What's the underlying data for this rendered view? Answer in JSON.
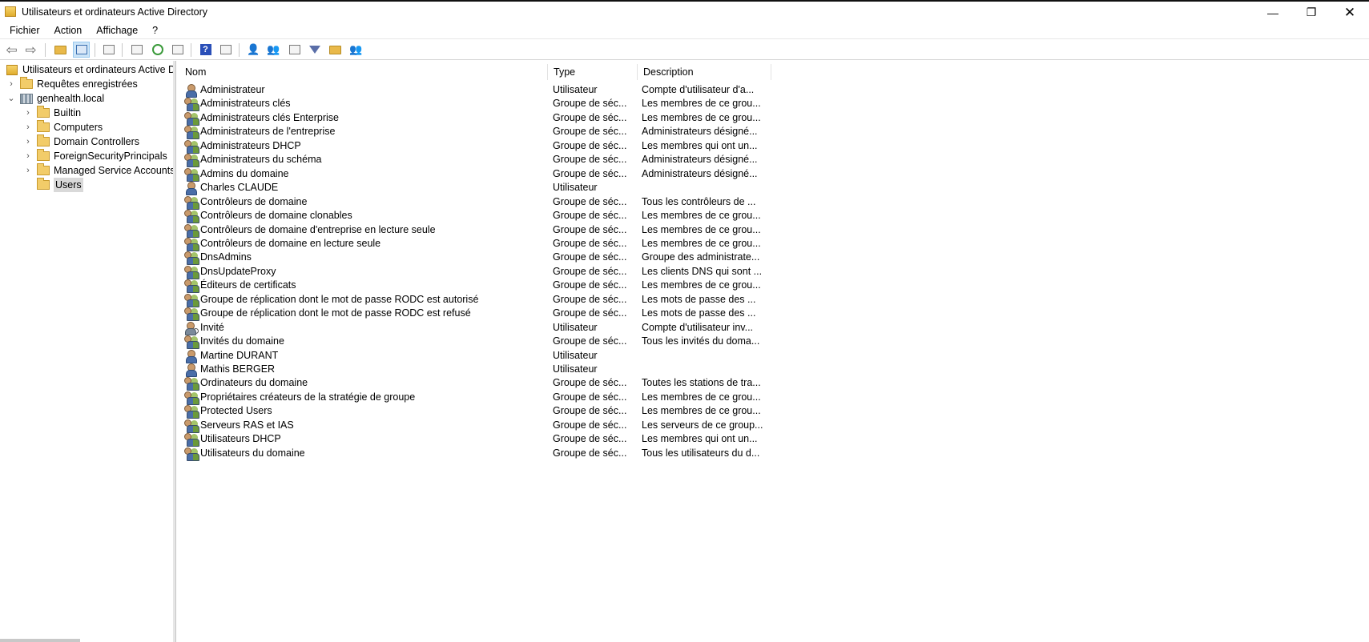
{
  "window": {
    "title": "Utilisateurs et ordinateurs Active Directory",
    "min_glyph": "—",
    "max_glyph": "❐",
    "close_glyph": "✕"
  },
  "menu": [
    "Fichier",
    "Action",
    "Affichage",
    "?"
  ],
  "toolbar": {
    "buttons": [
      {
        "name": "back-button",
        "icon": "arrow-left-icon"
      },
      {
        "name": "forward-button",
        "icon": "arrow-right-icon"
      },
      {
        "name": "up-level-button",
        "icon": "folder-up-icon"
      },
      {
        "name": "show-hide-tree-button",
        "icon": "console-tree-icon",
        "selected": true
      },
      {
        "name": "clipboard-button",
        "icon": "clipboard-icon"
      },
      {
        "name": "properties-button",
        "icon": "properties-icon"
      },
      {
        "name": "refresh-button",
        "icon": "refresh-icon"
      },
      {
        "name": "export-list-button",
        "icon": "export-icon"
      },
      {
        "name": "help-button",
        "icon": "help-icon"
      },
      {
        "name": "action-pane-button",
        "icon": "pane-icon"
      },
      {
        "name": "new-user-button",
        "icon": "new-user-icon"
      },
      {
        "name": "new-group-button",
        "icon": "new-group-icon"
      },
      {
        "name": "new-ou-button",
        "icon": "new-ou-icon"
      },
      {
        "name": "filter-button",
        "icon": "filter-icon"
      },
      {
        "name": "find-button",
        "icon": "find-icon"
      },
      {
        "name": "add-to-group-button",
        "icon": "add-to-group-icon"
      }
    ]
  },
  "tree": {
    "root": "Utilisateurs et ordinateurs Active Directory",
    "items": [
      {
        "label": "Requêtes enregistrées",
        "chevron": "›",
        "level": 1
      },
      {
        "label": "genhealth.local",
        "chevron": "⌄",
        "level": 1
      },
      {
        "label": "Builtin",
        "chevron": "›",
        "level": 2
      },
      {
        "label": "Computers",
        "chevron": "›",
        "level": 2
      },
      {
        "label": "Domain Controllers",
        "chevron": "›",
        "level": 2
      },
      {
        "label": "ForeignSecurityPrincipals",
        "chevron": "›",
        "level": 2
      },
      {
        "label": "Managed Service Accounts",
        "chevron": "›",
        "level": 2
      },
      {
        "label": "Users",
        "chevron": "",
        "level": 2,
        "selected": true
      }
    ]
  },
  "list": {
    "columns": {
      "name": "Nom",
      "type": "Type",
      "description": "Description"
    },
    "rows": [
      {
        "name": "Administrateur",
        "type": "Utilisateur",
        "desc": "Compte d'utilisateur d'a...",
        "kind": "user"
      },
      {
        "name": "Administrateurs clés",
        "type": "Groupe de séc...",
        "desc": "Les membres de ce grou...",
        "kind": "group"
      },
      {
        "name": "Administrateurs clés Enterprise",
        "type": "Groupe de séc...",
        "desc": "Les membres de ce grou...",
        "kind": "group"
      },
      {
        "name": "Administrateurs de l'entreprise",
        "type": "Groupe de séc...",
        "desc": "Administrateurs désigné...",
        "kind": "group"
      },
      {
        "name": "Administrateurs DHCP",
        "type": "Groupe de séc...",
        "desc": "Les membres qui ont un...",
        "kind": "group"
      },
      {
        "name": "Administrateurs du schéma",
        "type": "Groupe de séc...",
        "desc": "Administrateurs désigné...",
        "kind": "group"
      },
      {
        "name": "Admins du domaine",
        "type": "Groupe de séc...",
        "desc": "Administrateurs désigné...",
        "kind": "group"
      },
      {
        "name": "Charles CLAUDE",
        "type": "Utilisateur",
        "desc": "",
        "kind": "user"
      },
      {
        "name": "Contrôleurs de domaine",
        "type": "Groupe de séc...",
        "desc": "Tous les contrôleurs de ...",
        "kind": "group"
      },
      {
        "name": "Contrôleurs de domaine clonables",
        "type": "Groupe de séc...",
        "desc": "Les membres de ce grou...",
        "kind": "group"
      },
      {
        "name": "Contrôleurs de domaine d'entreprise en lecture seule",
        "type": "Groupe de séc...",
        "desc": "Les membres de ce grou...",
        "kind": "group"
      },
      {
        "name": "Contrôleurs de domaine en lecture seule",
        "type": "Groupe de séc...",
        "desc": "Les membres de ce grou...",
        "kind": "group"
      },
      {
        "name": "DnsAdmins",
        "type": "Groupe de séc...",
        "desc": "Groupe des administrate...",
        "kind": "group"
      },
      {
        "name": "DnsUpdateProxy",
        "type": "Groupe de séc...",
        "desc": "Les clients DNS qui sont ...",
        "kind": "group"
      },
      {
        "name": "Éditeurs de certificats",
        "type": "Groupe de séc...",
        "desc": "Les membres de ce grou...",
        "kind": "group"
      },
      {
        "name": "Groupe de réplication dont le mot de passe RODC est autorisé",
        "type": "Groupe de séc...",
        "desc": "Les mots de passe des ...",
        "kind": "group"
      },
      {
        "name": "Groupe de réplication dont le mot de passe RODC est refusé",
        "type": "Groupe de séc...",
        "desc": "Les mots de passe des ...",
        "kind": "group"
      },
      {
        "name": "Invité",
        "type": "Utilisateur",
        "desc": "Compte d'utilisateur inv...",
        "kind": "guest"
      },
      {
        "name": "Invités du domaine",
        "type": "Groupe de séc...",
        "desc": "Tous les invités du doma...",
        "kind": "group"
      },
      {
        "name": "Martine DURANT",
        "type": "Utilisateur",
        "desc": "",
        "kind": "user"
      },
      {
        "name": "Mathis BERGER",
        "type": "Utilisateur",
        "desc": "",
        "kind": "user"
      },
      {
        "name": "Ordinateurs du domaine",
        "type": "Groupe de séc...",
        "desc": "Toutes les stations de tra...",
        "kind": "group"
      },
      {
        "name": "Propriétaires créateurs de la stratégie de groupe",
        "type": "Groupe de séc...",
        "desc": "Les membres de ce grou...",
        "kind": "group"
      },
      {
        "name": "Protected Users",
        "type": "Groupe de séc...",
        "desc": "Les membres de ce grou...",
        "kind": "group"
      },
      {
        "name": "Serveurs RAS et IAS",
        "type": "Groupe de séc...",
        "desc": "Les serveurs de ce group...",
        "kind": "group"
      },
      {
        "name": "Utilisateurs DHCP",
        "type": "Groupe de séc...",
        "desc": "Les membres qui ont un...",
        "kind": "group"
      },
      {
        "name": "Utilisateurs du domaine",
        "type": "Groupe de séc...",
        "desc": "Tous les utilisateurs du d...",
        "kind": "group"
      }
    ]
  },
  "colors": {
    "accent_selected": "#cce4f7",
    "tree_selected": "#d9d9d9"
  }
}
